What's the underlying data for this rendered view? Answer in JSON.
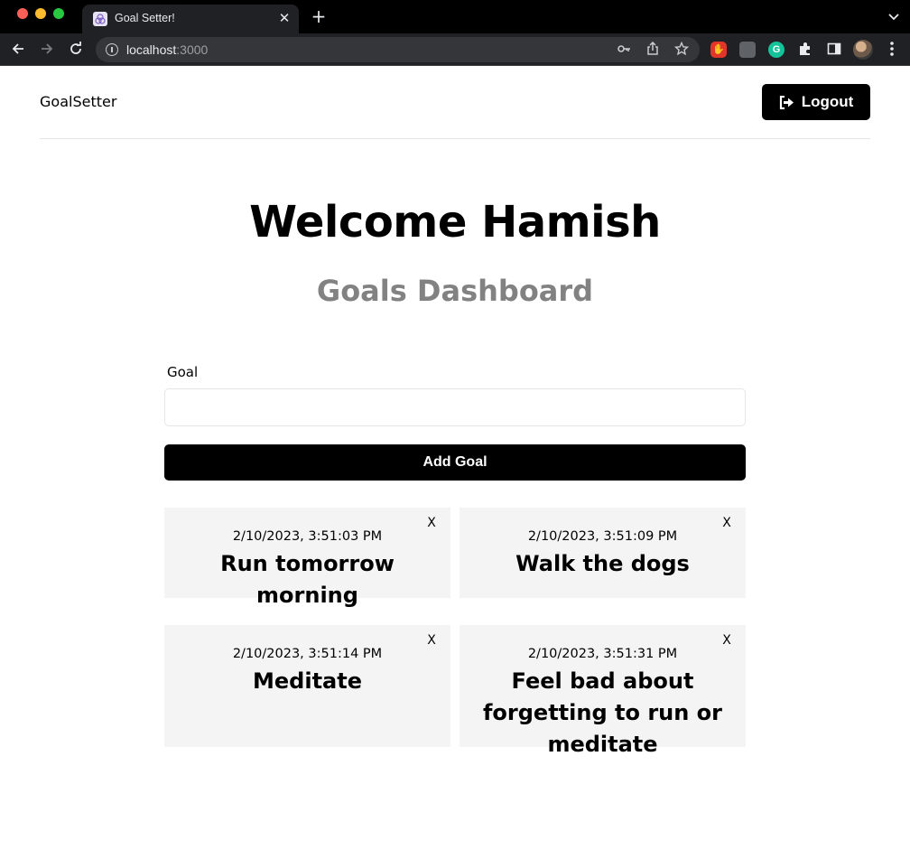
{
  "browser": {
    "tab_title": "Goal Setter!",
    "tab_close": "✕",
    "new_tab": "+",
    "url_host": "localhost",
    "url_port": ":3000",
    "icons": [
      "back-icon",
      "forward-icon",
      "reload-icon",
      "info-icon",
      "key-icon",
      "share-icon",
      "star-icon",
      "extensions-icon",
      "sidebar-icon",
      "profile-avatar",
      "menu-icon"
    ]
  },
  "header": {
    "brand": "GoalSetter",
    "logout_label": "Logout",
    "logout_icon": "sign-out-icon"
  },
  "main": {
    "welcome": "Welcome Hamish",
    "subtitle": "Goals Dashboard",
    "form": {
      "label": "Goal",
      "input_value": "",
      "add_button": "Add Goal"
    },
    "goals": [
      {
        "date": "2/10/2023, 3:51:03 PM",
        "text": "Run tomorrow morning",
        "close": "X"
      },
      {
        "date": "2/10/2023, 3:51:09 PM",
        "text": "Walk the dogs",
        "close": "X"
      },
      {
        "date": "2/10/2023, 3:51:14 PM",
        "text": "Meditate",
        "close": "X"
      },
      {
        "date": "2/10/2023, 3:51:31 PM",
        "text": "Feel bad about forgetting to run or meditate",
        "close": "X"
      }
    ]
  },
  "colors": {
    "accent": "#000000",
    "subtitle": "#828282",
    "card_bg": "#f4f4f4",
    "chrome_bg": "#202124"
  }
}
